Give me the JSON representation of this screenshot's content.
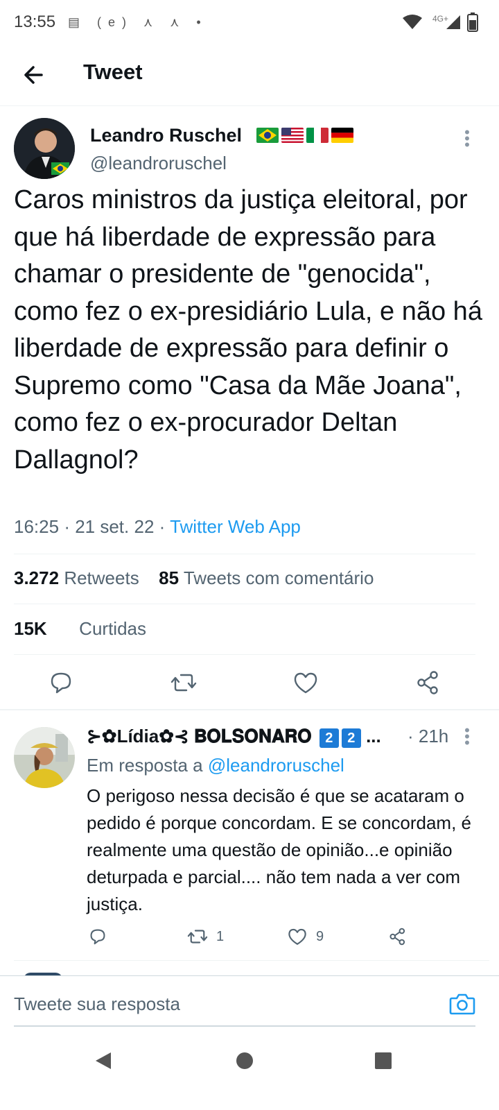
{
  "status_bar": {
    "time": "13:55",
    "left_icons": "▤ (e) ⋏ ⋏ •",
    "network": "4G+"
  },
  "header": {
    "title": "Tweet"
  },
  "tweet": {
    "author_name": "Leandro Ruschel",
    "author_handle": "@leandroruschel",
    "text": "Caros ministros da justiça eleitoral, por que há liberdade de expressão para chamar o presidente de \"genocida\", como fez o ex-presidiário Lula, e não há liberdade de expressão para definir o Supremo como \"Casa da Mãe Joana\", como fez o ex-procurador Deltan Dallagnol?",
    "time": "16:25",
    "date": "21 set. 22",
    "source": "Twitter Web App",
    "retweets_count": "3.272",
    "retweets_label": "Retweets",
    "quotes_count": "85",
    "quotes_label": "Tweets com comentário",
    "likes_count": "15K",
    "likes_label": "Curtidas"
  },
  "reply": {
    "author_name": "⊱✿Lídia✿⊰ 𝐁𝐎𝐋𝐒𝐎𝐍𝐀𝐑𝐎",
    "badge1": "2",
    "badge2": "2",
    "ellipsis": "...",
    "time_ago": "· 21h",
    "replying_prefix": "Em resposta a",
    "replying_handle": "@leandroruschel",
    "text": "O perigoso nessa decisão é que se acataram o pedido é porque concordam. E se concordam, é realmente uma questão de opinião...e opinião deturpada e parcial.... não tem nada a ver com justiça.",
    "retweet_count": "1",
    "like_count": "9"
  },
  "compose": {
    "placeholder": "Tweete sua resposta"
  },
  "colors": {
    "accent": "#1d9bf0",
    "secondary_text": "#536471",
    "primary_text": "#0f1419",
    "separator": "#eff3f4"
  },
  "icons": [
    "back-arrow-icon",
    "more-vertical-icon",
    "reply-icon",
    "retweet-icon",
    "like-icon",
    "share-icon",
    "camera-icon",
    "nav-back-icon",
    "nav-home-icon",
    "nav-recents-icon",
    "wifi-icon",
    "signal-icon",
    "battery-icon"
  ]
}
